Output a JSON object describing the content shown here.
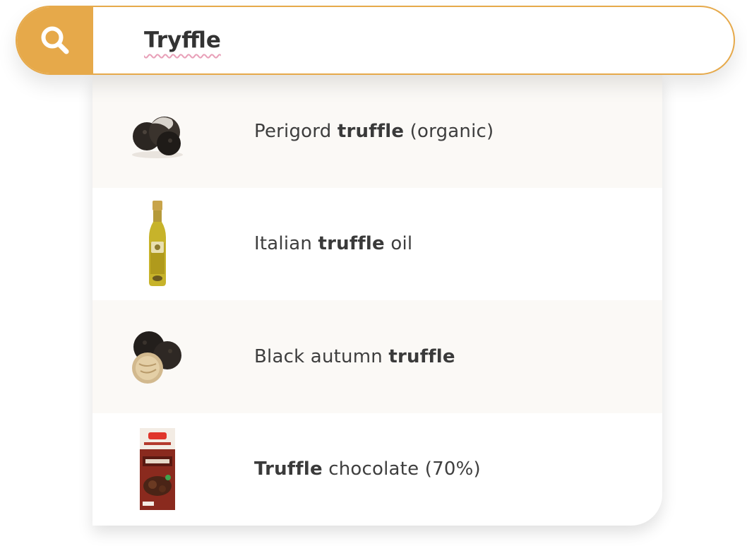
{
  "search": {
    "query": "Tryffle",
    "icon": "search-icon",
    "accent_color": "#e6a94a"
  },
  "results": [
    {
      "image": "perigord-truffle-image",
      "parts": [
        {
          "text": "Perigord ",
          "bold": false
        },
        {
          "text": "truffle",
          "bold": true
        },
        {
          "text": " (organic)",
          "bold": false
        }
      ]
    },
    {
      "image": "truffle-oil-bottle-image",
      "parts": [
        {
          "text": "Italian ",
          "bold": false
        },
        {
          "text": "truffle",
          "bold": true
        },
        {
          "text": " oil",
          "bold": false
        }
      ]
    },
    {
      "image": "black-autumn-truffle-image",
      "parts": [
        {
          "text": "Black autumn ",
          "bold": false
        },
        {
          "text": "truffle",
          "bold": true
        }
      ]
    },
    {
      "image": "truffle-chocolate-bar-image",
      "parts": [
        {
          "text": "Truffle",
          "bold": true
        },
        {
          "text": " chocolate (70%)",
          "bold": false
        }
      ]
    }
  ],
  "colors": {
    "row_alt_bg": "#fbf9f6",
    "text": "#3e3e3e",
    "spellcheck_underline": "#e8a0b8"
  }
}
